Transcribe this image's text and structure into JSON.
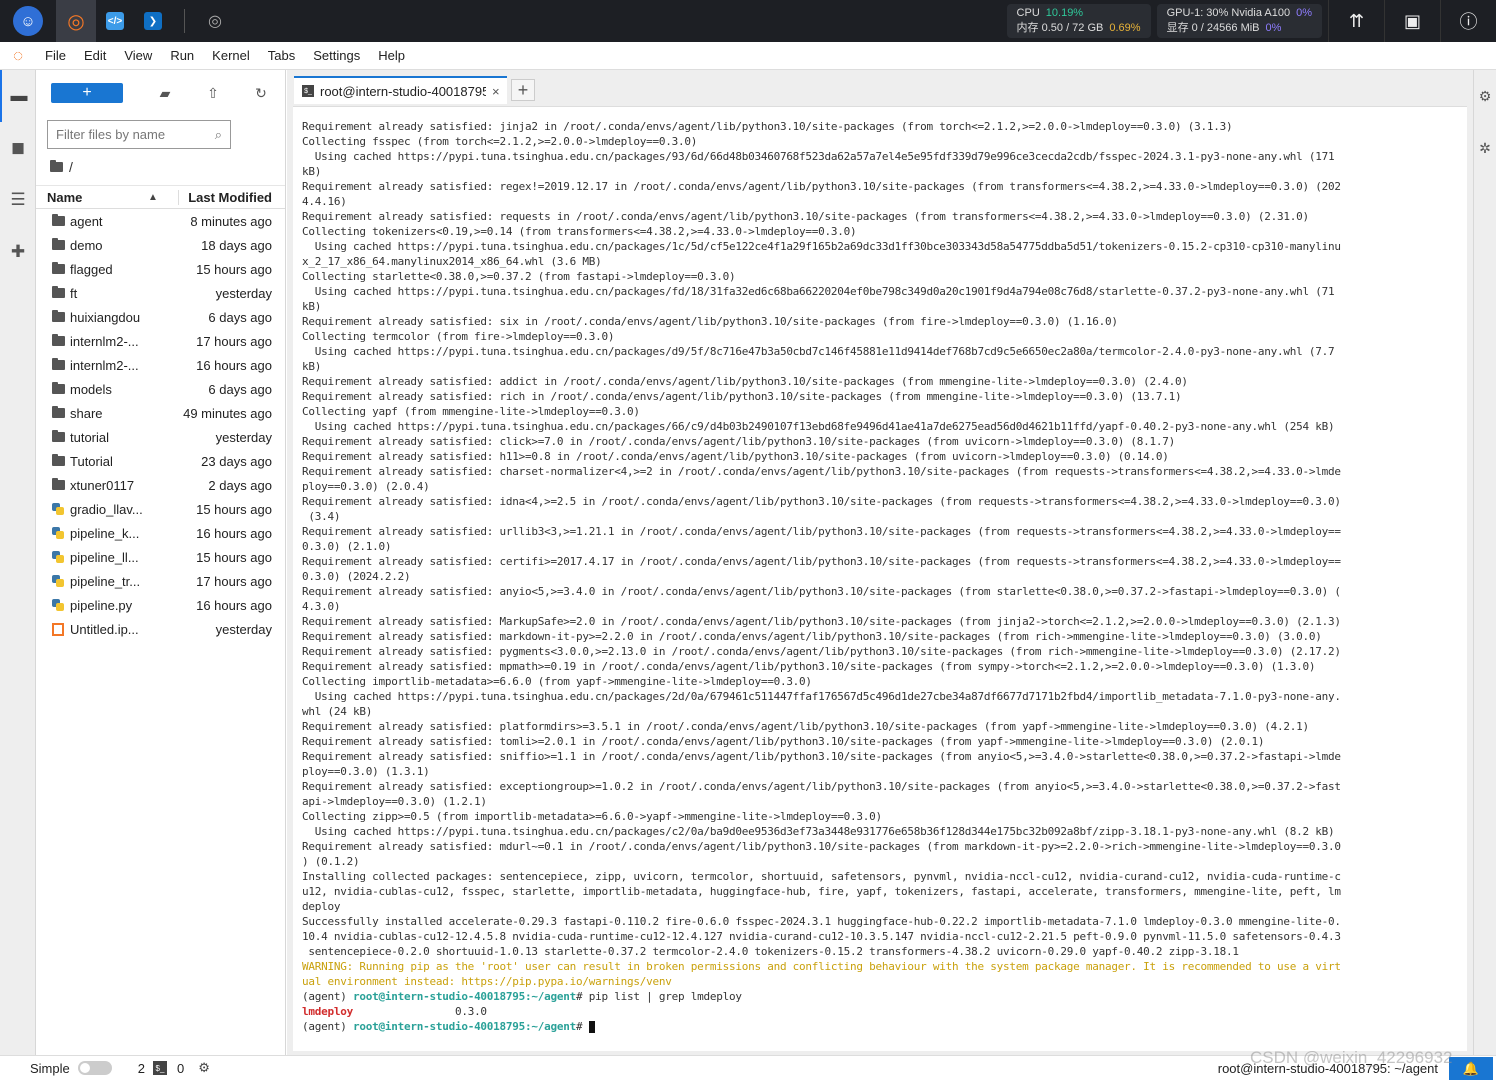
{
  "colors": {
    "accent": "#1976d2",
    "jupyter_orange": "#f37726",
    "topbar_bg": "#1d1f24",
    "warning": "#c9a10d",
    "prompt": "#2aa198",
    "match": "#d12c2c"
  },
  "topbar": {
    "resources": {
      "cpu_label": "CPU",
      "cpu_pct": "10.19%",
      "mem_label": "内存 0.50 / 72 GB",
      "mem_pct": "0.69%",
      "gpu_label": "GPU-1: 30% Nvidia A100",
      "gpu_pct": "0%",
      "vram_label": "显存 0 / 24566 MiB",
      "vram_pct": "0%"
    },
    "icons": [
      "app-logo-icon",
      "jupyter-icon",
      "code-editor-icon",
      "vscode-icon",
      "compass-icon",
      "upload-arrow-icon",
      "monitor-icon",
      "info-icon"
    ]
  },
  "menu": [
    "File",
    "Edit",
    "View",
    "Run",
    "Kernel",
    "Tabs",
    "Settings",
    "Help"
  ],
  "filebrowser": {
    "new_label": "+",
    "filter_placeholder": "Filter files by name",
    "breadcrumb": "/",
    "col_name": "Name",
    "col_modified": "Last Modified",
    "files": [
      {
        "name": "agent",
        "modified": "8 minutes ago",
        "type": "folder"
      },
      {
        "name": "demo",
        "modified": "18 days ago",
        "type": "folder"
      },
      {
        "name": "flagged",
        "modified": "15 hours ago",
        "type": "folder"
      },
      {
        "name": "ft",
        "modified": "yesterday",
        "type": "folder"
      },
      {
        "name": "huixiangdou",
        "modified": "6 days ago",
        "type": "folder"
      },
      {
        "name": "internlm2-...",
        "modified": "17 hours ago",
        "type": "folder"
      },
      {
        "name": "internlm2-...",
        "modified": "16 hours ago",
        "type": "folder"
      },
      {
        "name": "models",
        "modified": "6 days ago",
        "type": "folder"
      },
      {
        "name": "share",
        "modified": "49 minutes ago",
        "type": "folder"
      },
      {
        "name": "tutorial",
        "modified": "yesterday",
        "type": "folder"
      },
      {
        "name": "Tutorial",
        "modified": "23 days ago",
        "type": "folder"
      },
      {
        "name": "xtuner0117",
        "modified": "2 days ago",
        "type": "folder"
      },
      {
        "name": "gradio_llav...",
        "modified": "15 hours ago",
        "type": "python"
      },
      {
        "name": "pipeline_k...",
        "modified": "16 hours ago",
        "type": "python"
      },
      {
        "name": "pipeline_ll...",
        "modified": "15 hours ago",
        "type": "python"
      },
      {
        "name": "pipeline_tr...",
        "modified": "17 hours ago",
        "type": "python"
      },
      {
        "name": "pipeline.py",
        "modified": "16 hours ago",
        "type": "python"
      },
      {
        "name": "Untitled.ip...",
        "modified": "yesterday",
        "type": "notebook"
      }
    ]
  },
  "tab": {
    "title": "root@intern-studio-40018795: ~/agent",
    "close": "×",
    "add": "+"
  },
  "terminal": {
    "lines": [
      {
        "t": "Requirement already satisfied: jinja2 in /root/.conda/envs/agent/lib/python3.10/site-packages (from torch<=2.1.2,>=2.0.0->lmdeploy==0.3.0) (3.1.3)"
      },
      {
        "t": "Collecting fsspec (from torch<=2.1.2,>=2.0.0->lmdeploy==0.3.0)"
      },
      {
        "t": "  Using cached https://pypi.tuna.tsinghua.edu.cn/packages/93/6d/66d48b03460768f523da62a57a7el4e5e95fdf339d79e996ce3cecda2cdb/fsspec-2024.3.1-py3-none-any.whl (171"
      },
      {
        "t": "kB)"
      },
      {
        "t": "Requirement already satisfied: regex!=2019.12.17 in /root/.conda/envs/agent/lib/python3.10/site-packages (from transformers<=4.38.2,>=4.33.0->lmdeploy==0.3.0) (202"
      },
      {
        "t": "4.4.16)"
      },
      {
        "t": "Requirement already satisfied: requests in /root/.conda/envs/agent/lib/python3.10/site-packages (from transformers<=4.38.2,>=4.33.0->lmdeploy==0.3.0) (2.31.0)"
      },
      {
        "t": "Collecting tokenizers<0.19,>=0.14 (from transformers<=4.38.2,>=4.33.0->lmdeploy==0.3.0)"
      },
      {
        "t": "  Using cached https://pypi.tuna.tsinghua.edu.cn/packages/1c/5d/cf5e122ce4f1a29f165b2a69dc33d1ff30bce303343d58a54775ddba5d51/tokenizers-0.15.2-cp310-cp310-manylinu"
      },
      {
        "t": "x_2_17_x86_64.manylinux2014_x86_64.whl (3.6 MB)"
      },
      {
        "t": "Collecting starlette<0.38.0,>=0.37.2 (from fastapi->lmdeploy==0.3.0)"
      },
      {
        "t": "  Using cached https://pypi.tuna.tsinghua.edu.cn/packages/fd/18/31fa32ed6c68ba66220204ef0be798c349d0a20c1901f9d4a794e08c76d8/starlette-0.37.2-py3-none-any.whl (71"
      },
      {
        "t": "kB)"
      },
      {
        "t": "Requirement already satisfied: six in /root/.conda/envs/agent/lib/python3.10/site-packages (from fire->lmdeploy==0.3.0) (1.16.0)"
      },
      {
        "t": "Collecting termcolor (from fire->lmdeploy==0.3.0)"
      },
      {
        "t": "  Using cached https://pypi.tuna.tsinghua.edu.cn/packages/d9/5f/8c716e47b3a50cbd7c146f45881e11d9414def768b7cd9c5e6650ec2a80a/termcolor-2.4.0-py3-none-any.whl (7.7"
      },
      {
        "t": "kB)"
      },
      {
        "t": "Requirement already satisfied: addict in /root/.conda/envs/agent/lib/python3.10/site-packages (from mmengine-lite->lmdeploy==0.3.0) (2.4.0)"
      },
      {
        "t": "Requirement already satisfied: rich in /root/.conda/envs/agent/lib/python3.10/site-packages (from mmengine-lite->lmdeploy==0.3.0) (13.7.1)"
      },
      {
        "t": "Collecting yapf (from mmengine-lite->lmdeploy==0.3.0)"
      },
      {
        "t": "  Using cached https://pypi.tuna.tsinghua.edu.cn/packages/66/c9/d4b03b2490107f13ebd68fe9496d41ae41a7de6275ead56d0d4621b11ffd/yapf-0.40.2-py3-none-any.whl (254 kB)"
      },
      {
        "t": "Requirement already satisfied: click>=7.0 in /root/.conda/envs/agent/lib/python3.10/site-packages (from uvicorn->lmdeploy==0.3.0) (8.1.7)"
      },
      {
        "t": "Requirement already satisfied: h11>=0.8 in /root/.conda/envs/agent/lib/python3.10/site-packages (from uvicorn->lmdeploy==0.3.0) (0.14.0)"
      },
      {
        "t": "Requirement already satisfied: charset-normalizer<4,>=2 in /root/.conda/envs/agent/lib/python3.10/site-packages (from requests->transformers<=4.38.2,>=4.33.0->lmde"
      },
      {
        "t": "ploy==0.3.0) (2.0.4)"
      },
      {
        "t": "Requirement already satisfied: idna<4,>=2.5 in /root/.conda/envs/agent/lib/python3.10/site-packages (from requests->transformers<=4.38.2,>=4.33.0->lmdeploy==0.3.0)"
      },
      {
        "t": " (3.4)"
      },
      {
        "t": "Requirement already satisfied: urllib3<3,>=1.21.1 in /root/.conda/envs/agent/lib/python3.10/site-packages (from requests->transformers<=4.38.2,>=4.33.0->lmdeploy=="
      },
      {
        "t": "0.3.0) (2.1.0)"
      },
      {
        "t": "Requirement already satisfied: certifi>=2017.4.17 in /root/.conda/envs/agent/lib/python3.10/site-packages (from requests->transformers<=4.38.2,>=4.33.0->lmdeploy=="
      },
      {
        "t": "0.3.0) (2024.2.2)"
      },
      {
        "t": "Requirement already satisfied: anyio<5,>=3.4.0 in /root/.conda/envs/agent/lib/python3.10/site-packages (from starlette<0.38.0,>=0.37.2->fastapi->lmdeploy==0.3.0) ("
      },
      {
        "t": "4.3.0)"
      },
      {
        "t": "Requirement already satisfied: MarkupSafe>=2.0 in /root/.conda/envs/agent/lib/python3.10/site-packages (from jinja2->torch<=2.1.2,>=2.0.0->lmdeploy==0.3.0) (2.1.3)"
      },
      {
        "t": "Requirement already satisfied: markdown-it-py>=2.2.0 in /root/.conda/envs/agent/lib/python3.10/site-packages (from rich->mmengine-lite->lmdeploy==0.3.0) (3.0.0)"
      },
      {
        "t": "Requirement already satisfied: pygments<3.0.0,>=2.13.0 in /root/.conda/envs/agent/lib/python3.10/site-packages (from rich->mmengine-lite->lmdeploy==0.3.0) (2.17.2)"
      },
      {
        "t": "Requirement already satisfied: mpmath>=0.19 in /root/.conda/envs/agent/lib/python3.10/site-packages (from sympy->torch<=2.1.2,>=2.0.0->lmdeploy==0.3.0) (1.3.0)"
      },
      {
        "t": "Collecting importlib-metadata>=6.6.0 (from yapf->mmengine-lite->lmdeploy==0.3.0)"
      },
      {
        "t": "  Using cached https://pypi.tuna.tsinghua.edu.cn/packages/2d/0a/679461c511447ffaf176567d5c496d1de27cbe34a87df6677d7171b2fbd4/importlib_metadata-7.1.0-py3-none-any."
      },
      {
        "t": "whl (24 kB)"
      },
      {
        "t": "Requirement already satisfied: platformdirs>=3.5.1 in /root/.conda/envs/agent/lib/python3.10/site-packages (from yapf->mmengine-lite->lmdeploy==0.3.0) (4.2.1)"
      },
      {
        "t": "Requirement already satisfied: tomli>=2.0.1 in /root/.conda/envs/agent/lib/python3.10/site-packages (from yapf->mmengine-lite->lmdeploy==0.3.0) (2.0.1)"
      },
      {
        "t": "Requirement already satisfied: sniffio>=1.1 in /root/.conda/envs/agent/lib/python3.10/site-packages (from anyio<5,>=3.4.0->starlette<0.38.0,>=0.37.2->fastapi->lmde"
      },
      {
        "t": "ploy==0.3.0) (1.3.1)"
      },
      {
        "t": "Requirement already satisfied: exceptiongroup>=1.0.2 in /root/.conda/envs/agent/lib/python3.10/site-packages (from anyio<5,>=3.4.0->starlette<0.38.0,>=0.37.2->fast"
      },
      {
        "t": "api->lmdeploy==0.3.0) (1.2.1)"
      },
      {
        "t": "Collecting zipp>=0.5 (from importlib-metadata>=6.6.0->yapf->mmengine-lite->lmdeploy==0.3.0)"
      },
      {
        "t": "  Using cached https://pypi.tuna.tsinghua.edu.cn/packages/c2/0a/ba9d0ee9536d3ef73a3448e931776e658b36f128d344e175bc32b092a8bf/zipp-3.18.1-py3-none-any.whl (8.2 kB)"
      },
      {
        "t": "Requirement already satisfied: mdurl~=0.1 in /root/.conda/envs/agent/lib/python3.10/site-packages (from markdown-it-py>=2.2.0->rich->mmengine-lite->lmdeploy==0.3.0"
      },
      {
        "t": ") (0.1.2)"
      },
      {
        "t": "Installing collected packages: sentencepiece, zipp, uvicorn, termcolor, shortuuid, safetensors, pynvml, nvidia-nccl-cu12, nvidia-curand-cu12, nvidia-cuda-runtime-c"
      },
      {
        "t": "u12, nvidia-cublas-cu12, fsspec, starlette, importlib-metadata, huggingface-hub, fire, yapf, tokenizers, fastapi, accelerate, transformers, mmengine-lite, peft, lm"
      },
      {
        "t": "deploy"
      },
      {
        "t": "Successfully installed accelerate-0.29.3 fastapi-0.110.2 fire-0.6.0 fsspec-2024.3.1 huggingface-hub-0.22.2 importlib-metadata-7.1.0 lmdeploy-0.3.0 mmengine-lite-0."
      },
      {
        "t": "10.4 nvidia-cublas-cu12-12.4.5.8 nvidia-cuda-runtime-cu12-12.4.127 nvidia-curand-cu12-10.3.5.147 nvidia-nccl-cu12-2.21.5 peft-0.9.0 pynvml-11.5.0 safetensors-0.4.3"
      },
      {
        "t": " sentencepiece-0.2.0 shortuuid-1.0.13 starlette-0.37.2 termcolor-2.4.0 tokenizers-0.15.2 transformers-4.38.2 uvicorn-0.29.0 yapf-0.40.2 zipp-3.18.1"
      },
      {
        "t": "WARNING: Running pip as the 'root' user can result in broken permissions and conflicting behaviour with the system package manager. It is recommended to use a virt",
        "k": "warn"
      },
      {
        "t": "ual environment instead: https://pip.pypa.io/warnings/venv",
        "k": "warn"
      }
    ],
    "prompt_env": "(agent) ",
    "prompt_host": "root@intern-studio-40018795",
    "prompt_path": ":~/agent",
    "prompt_sym": "# ",
    "command": "pip list | grep lmdeploy",
    "result_pkg": "lmdeploy",
    "result_ver": "                0.3.0"
  },
  "statusbar": {
    "mode": "Simple",
    "kernels": "2",
    "terminals": "0",
    "path": "root@intern-studio-40018795: ~/agent"
  },
  "watermark": "CSDN @weixin_42296932"
}
